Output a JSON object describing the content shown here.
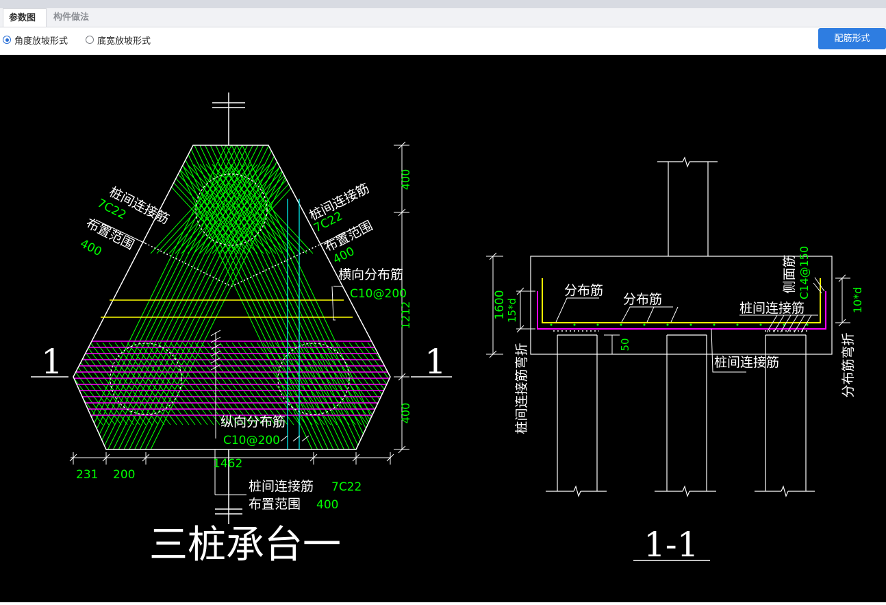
{
  "tabs": [
    {
      "label": "参数图",
      "active": true
    },
    {
      "label": "构件做法",
      "active": false
    }
  ],
  "options": {
    "radio1": "角度放坡形式",
    "radio2": "底宽放坡形式",
    "selected": "角度放坡形式"
  },
  "button": {
    "label": "配筋形式"
  },
  "colors": {
    "accent": "#2e7de1",
    "green": "#00ff00",
    "white": "#ffffff",
    "yellow": "#ffff00",
    "magenta": "#ff00ff",
    "cyan": "#00ffff"
  },
  "plan": {
    "title": "三桩承台一",
    "section_mark": "1",
    "lbl_conn_left": "桩间连接筋",
    "val_conn_left": "7C22",
    "lbl_range_left": "布置范围",
    "val_range_left": "400",
    "lbl_conn_right": "桩间连接筋",
    "val_conn_right": "7C22",
    "lbl_range_right": "布置范围",
    "val_range_right": "400",
    "lbl_horiz": "横向分布筋",
    "val_horiz": "C10@200",
    "lbl_vert": "纵向分布筋",
    "val_vert": "C10@200",
    "lbl_conn_bottom": "桩间连接筋",
    "val_conn_bottom": "7C22",
    "lbl_range_bottom": "布置范围",
    "val_range_bottom": "400",
    "dim_top": "400",
    "dim_mid": "1212",
    "dim_bot": "400",
    "dim_a": "231",
    "dim_b": "200",
    "dim_w": "1462"
  },
  "section": {
    "title": "1-1",
    "lbl_dist1": "分布筋",
    "lbl_dist2": "分布筋",
    "lbl_conn_top": "桩间连接筋",
    "lbl_conn_bottom": "桩间连接筋",
    "lbl_side": "侧面筋",
    "val_side": "C14@150",
    "dim_height": "1600",
    "val_15d": "15*d",
    "val_10d": "10*d",
    "val_50": "50",
    "lbl_conn_bend": "桩间连接筋弯折",
    "lbl_dist_bend": "分布筋弯折"
  }
}
